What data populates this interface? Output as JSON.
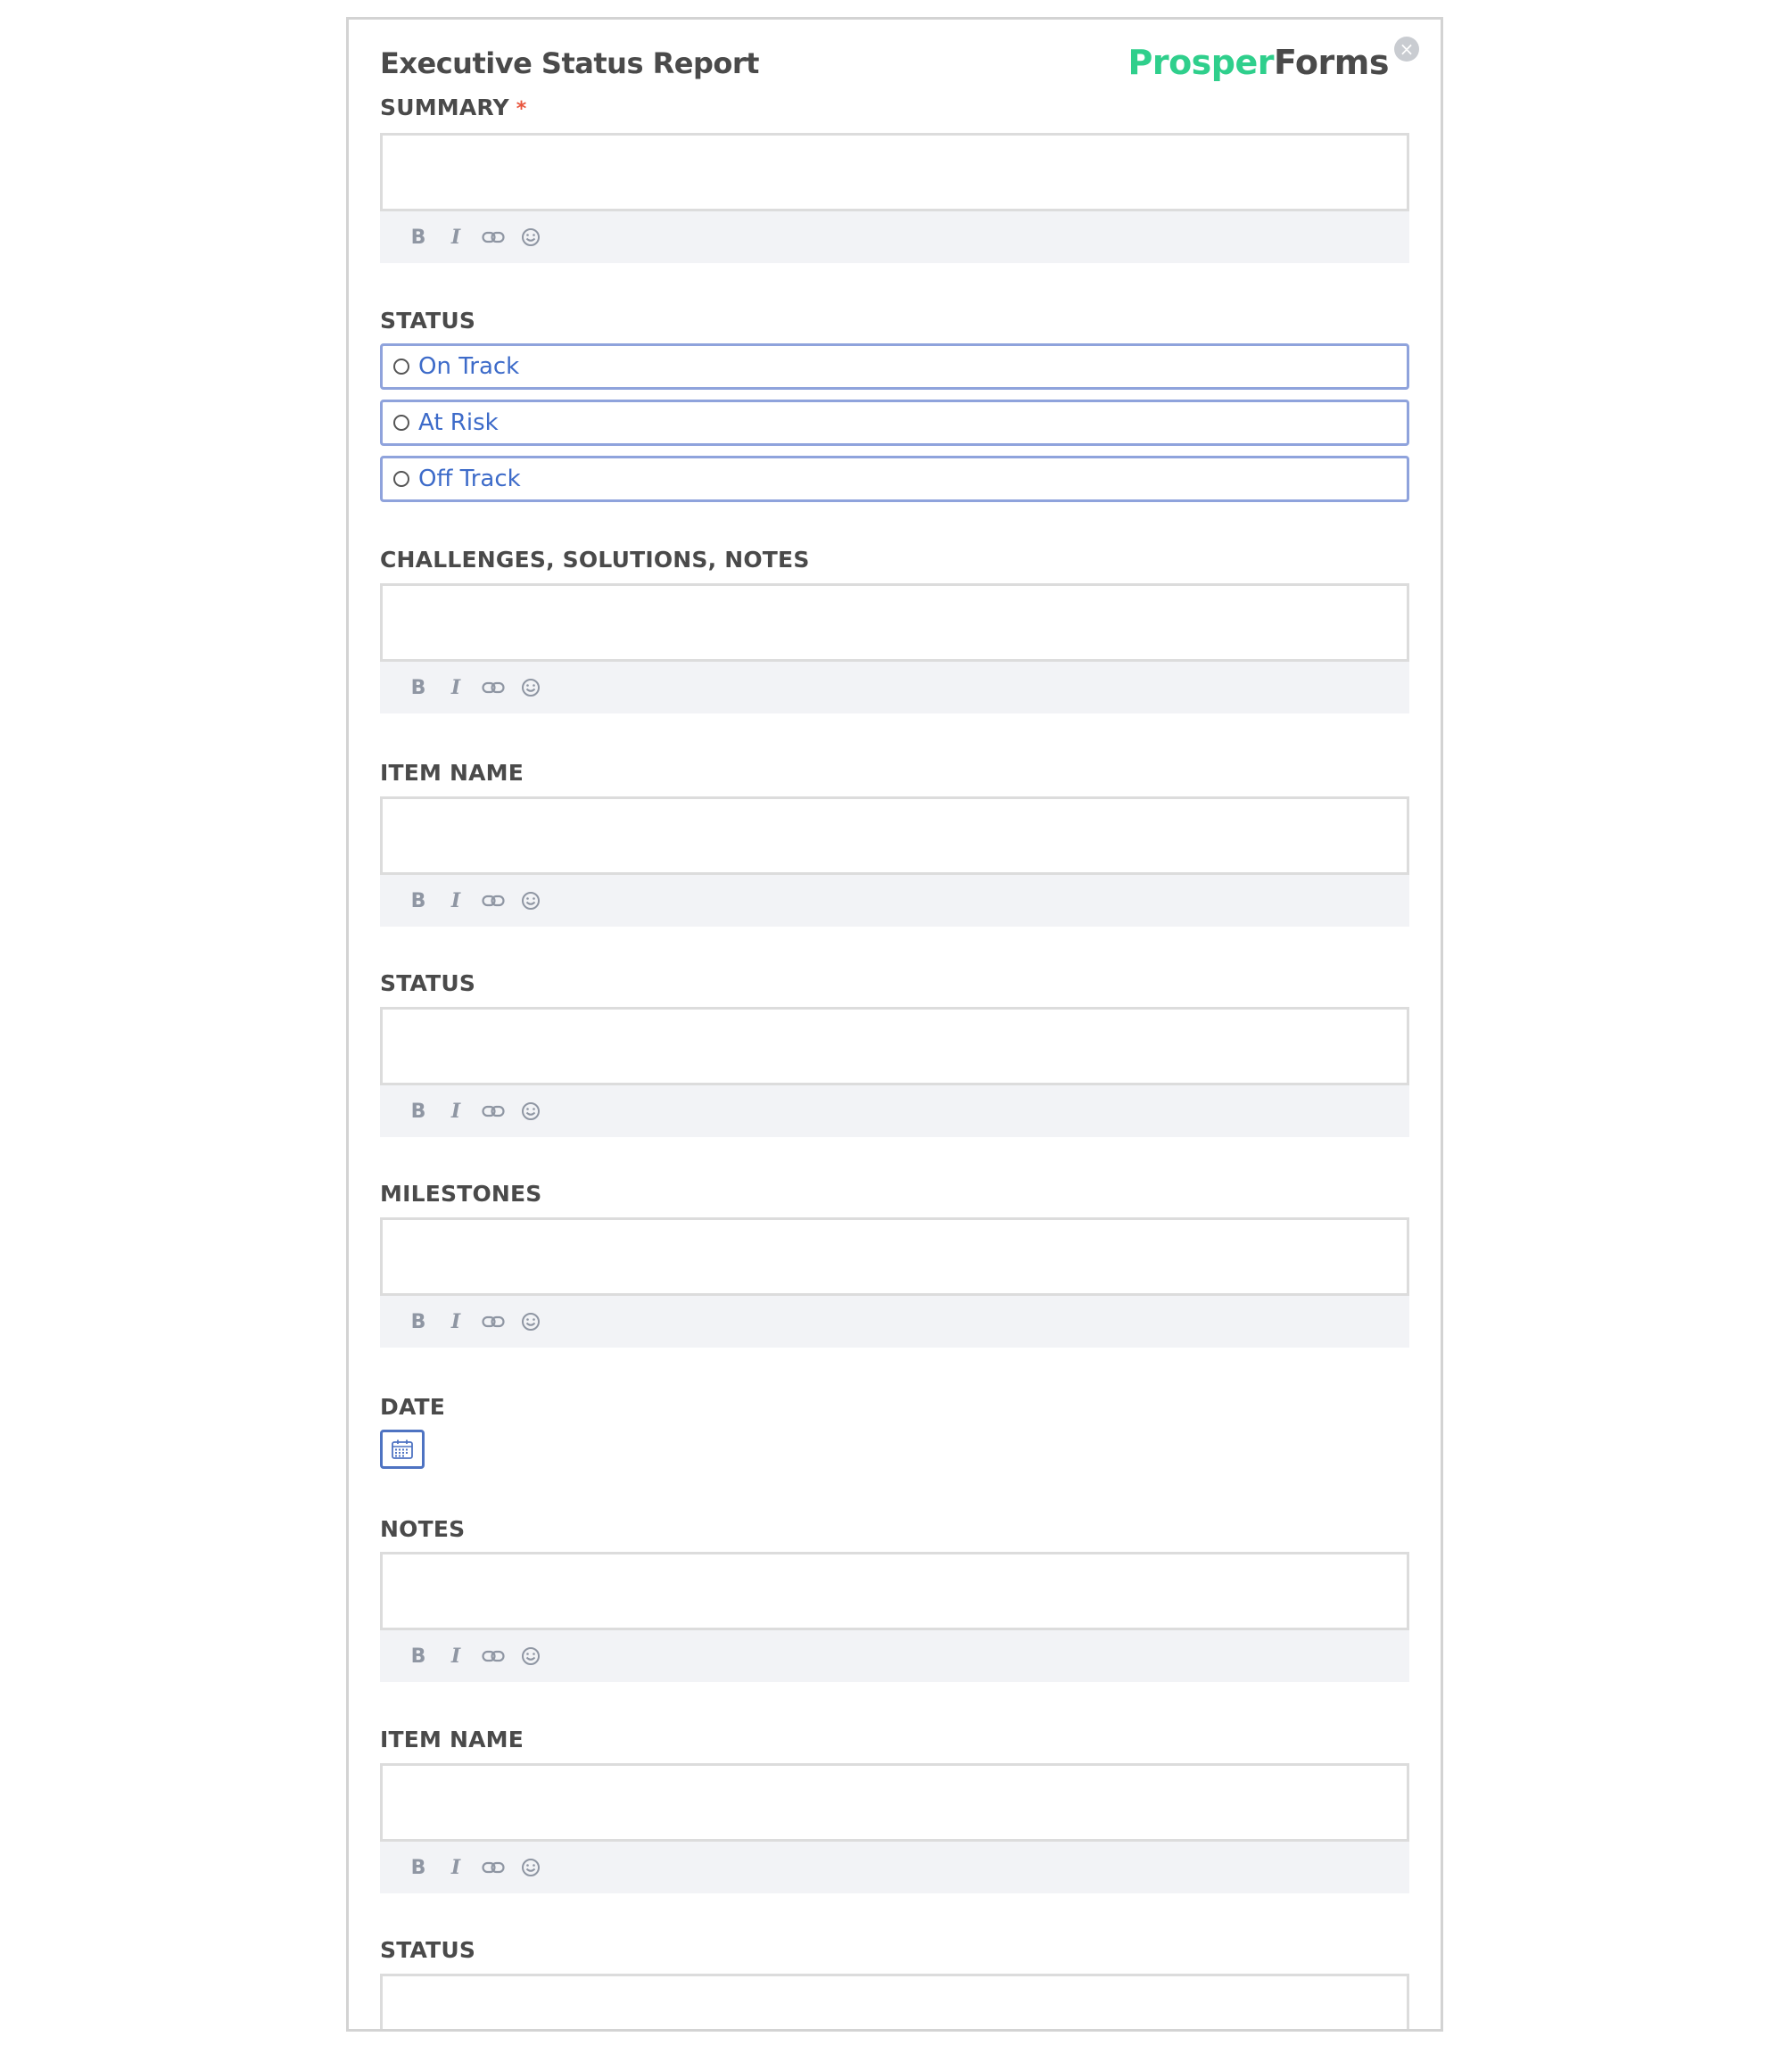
{
  "form": {
    "title": "Executive Status Report",
    "brand": {
      "part1": "Prosper",
      "part2": "Forms"
    },
    "close_glyph": "×"
  },
  "toolbar": {
    "bold": "B",
    "italic": "I"
  },
  "fields": {
    "summary": {
      "label": "SUMMARY",
      "required_mark": "*"
    },
    "status1": {
      "label": "STATUS",
      "options": [
        "On Track",
        "At Risk",
        "Off Track"
      ]
    },
    "challenges": {
      "label": "CHALLENGES, SOLUTIONS, NOTES"
    },
    "item_name1": {
      "label": "ITEM NAME"
    },
    "status2": {
      "label": "STATUS"
    },
    "milestones": {
      "label": "MILESTONES"
    },
    "date": {
      "label": "DATE"
    },
    "notes": {
      "label": "NOTES"
    },
    "item_name2": {
      "label": "ITEM NAME"
    },
    "status3": {
      "label": "STATUS"
    }
  },
  "icons": {
    "link": "link-icon",
    "emoji": "smile-icon",
    "calendar": "calendar-icon",
    "close": "close-icon"
  },
  "colors": {
    "brand_green": "#2fcf8c",
    "radio_text": "#3d6bc9",
    "radio_border": "#8fa3dc",
    "required": "#e8553d",
    "toolbar_bg": "#f2f3f6"
  }
}
